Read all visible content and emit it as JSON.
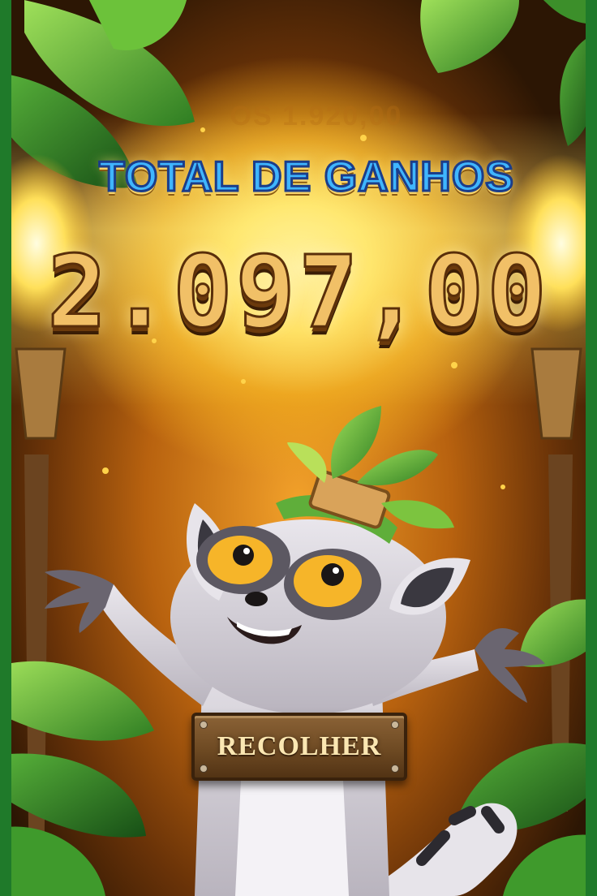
{
  "screen": {
    "name": "win-summary",
    "background_ghost_text": "OS 1.920,00",
    "title": "TOTAL DE GANHOS",
    "total_amount": "2.097,00",
    "collect_button_label": "RECOLHER"
  },
  "colors": {
    "title_fill": "#3fb6ff",
    "title_outline": "#1b3d8a",
    "amount_fill": "#f1c067",
    "button_wood": "#6e4a23",
    "button_text": "#fbe7b2",
    "glow": "#ffe46a",
    "foliage": "#3f9a2c"
  },
  "icons": {
    "character": "lemur-character",
    "foliage": "jungle-leaves",
    "torches": "tiki-torch"
  }
}
